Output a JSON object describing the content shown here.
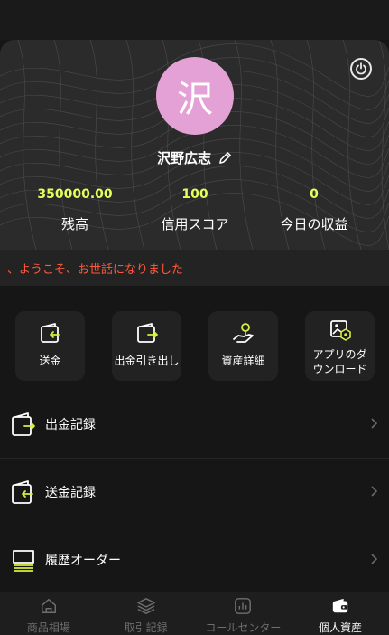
{
  "profile": {
    "avatar_char": "沢",
    "name": "沢野広志",
    "stats": [
      {
        "value": "350000.00",
        "label": "残高"
      },
      {
        "value": "100",
        "label": "信用スコア"
      },
      {
        "value": "0",
        "label": "今日の収益"
      }
    ]
  },
  "notice": "、ようこそ、お世話になりました",
  "quick_actions": [
    {
      "label": "送金",
      "icon": "wallet-in-icon"
    },
    {
      "label": "出金引き出し",
      "icon": "wallet-out-icon"
    },
    {
      "label": "資産詳細",
      "icon": "hand-coin-icon"
    },
    {
      "label": "アプリのダウンロード",
      "icon": "app-download-icon"
    }
  ],
  "menu": [
    {
      "label": "出金記録",
      "icon": "withdraw-record-icon"
    },
    {
      "label": "送金記録",
      "icon": "transfer-record-icon"
    },
    {
      "label": "履歴オーダー",
      "icon": "order-history-icon"
    }
  ],
  "tabs": [
    {
      "label": "商品相場",
      "icon": "home-icon",
      "active": false
    },
    {
      "label": "取引記録",
      "icon": "layers-icon",
      "active": false
    },
    {
      "label": "コールセンター",
      "icon": "chart-icon",
      "active": false
    },
    {
      "label": "個人資産",
      "icon": "wallet-icon",
      "active": true
    }
  ],
  "colors": {
    "accent": "#e6ff5c",
    "avatar_bg": "#e3a1d6",
    "notice": "#ff5a3c",
    "icon_yellow": "#d8ef3a"
  }
}
